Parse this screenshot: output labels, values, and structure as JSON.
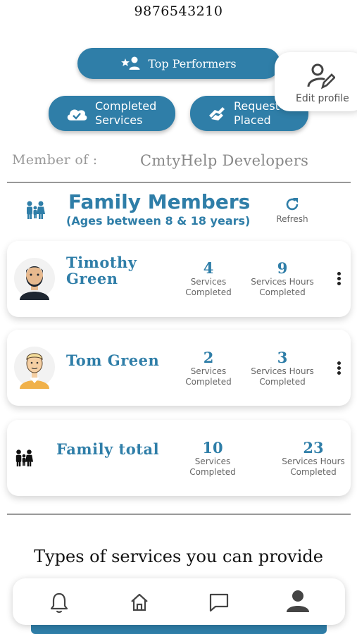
{
  "header": {
    "phone": "9876543210"
  },
  "actions": {
    "top_performers": "Top Performers",
    "completed_services_line1": "Completed",
    "completed_services_line2": "Services",
    "request_placed_line1": "Request",
    "request_placed_line2": "Placed",
    "edit_profile": "Edit profile"
  },
  "membership": {
    "label": "Member of :",
    "org": "CmtyHelp Developers"
  },
  "family": {
    "title": "Family Members",
    "subtitle": "(Ages between 8 & 18 years)",
    "refresh_label": "Refresh",
    "members": [
      {
        "name_line1": "Timothy",
        "name_line2": "Green",
        "services": "4",
        "services_cap1": "Services",
        "services_cap2": "Completed",
        "hours": "9",
        "hours_cap1": "Services Hours",
        "hours_cap2": "Completed"
      },
      {
        "name_line1": "Tom Green",
        "name_line2": "",
        "services": "2",
        "services_cap1": "Services",
        "services_cap2": "Completed",
        "hours": "3",
        "hours_cap1": "Services Hours",
        "hours_cap2": "Completed"
      }
    ],
    "total": {
      "label": "Family total",
      "services": "10",
      "services_cap1": "Services",
      "services_cap2": "Completed",
      "hours": "23",
      "hours_cap1": "Services Hours",
      "hours_cap2": "Completed"
    }
  },
  "types_title": "Types of services you can provide",
  "nav": {
    "items": [
      "bell-icon",
      "home-icon",
      "chat-icon",
      "profile-icon"
    ]
  },
  "colors": {
    "accent": "#2f7ea8",
    "muted": "#999999"
  }
}
